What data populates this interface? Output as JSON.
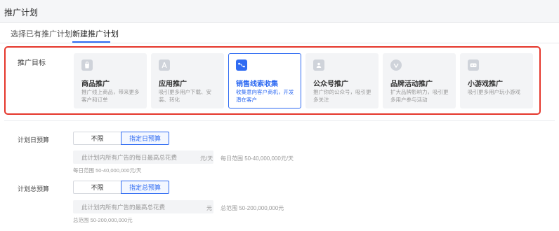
{
  "header": {
    "title": "推广计划"
  },
  "tabs": [
    {
      "label": "选择已有推广计划"
    },
    {
      "label": "新建推广计划"
    }
  ],
  "goal": {
    "label": "推广目标",
    "cards": [
      {
        "icon": "shopping-bag-icon",
        "name": "商品推广",
        "desc": "推广线上商品，带来更多客户和订单"
      },
      {
        "icon": "app-store-icon",
        "name": "应用推广",
        "desc": "吸引更多用户下载、安装、转化"
      },
      {
        "icon": "route-icon",
        "name": "销售线索收集",
        "desc": "收集意向客户商机，开发潜在客户"
      },
      {
        "icon": "contact-card-icon",
        "name": "公众号推广",
        "desc": "推广你的公众号，吸引更多关注"
      },
      {
        "icon": "brand-badge-icon",
        "name": "品牌活动推广",
        "desc": "扩大品牌影响力，吸引更多用户参与活动"
      },
      {
        "icon": "gamepad-icon",
        "name": "小游戏推广",
        "desc": "吸引更多用户玩小游戏"
      }
    ]
  },
  "daily_budget": {
    "label": "计划日预算",
    "options": [
      "不限",
      "指定日预算"
    ],
    "placeholder": "此计划内所有广告的每日最高总花费",
    "unit": "元/天",
    "range_side": "每日范围 50-40,000,000元/天",
    "range_below": "每日范围 50-40,000,000元/天"
  },
  "total_budget": {
    "label": "计划总预算",
    "options": [
      "不限",
      "指定总预算"
    ],
    "placeholder": "此计划内所有广告的最高总花费",
    "unit": "元",
    "range_side": "总范围 50-200,000,000元",
    "range_below": "总范围 50-200,000,000元"
  },
  "colors": {
    "accent": "#2f6bf2",
    "highlight_border": "#e5362b"
  }
}
